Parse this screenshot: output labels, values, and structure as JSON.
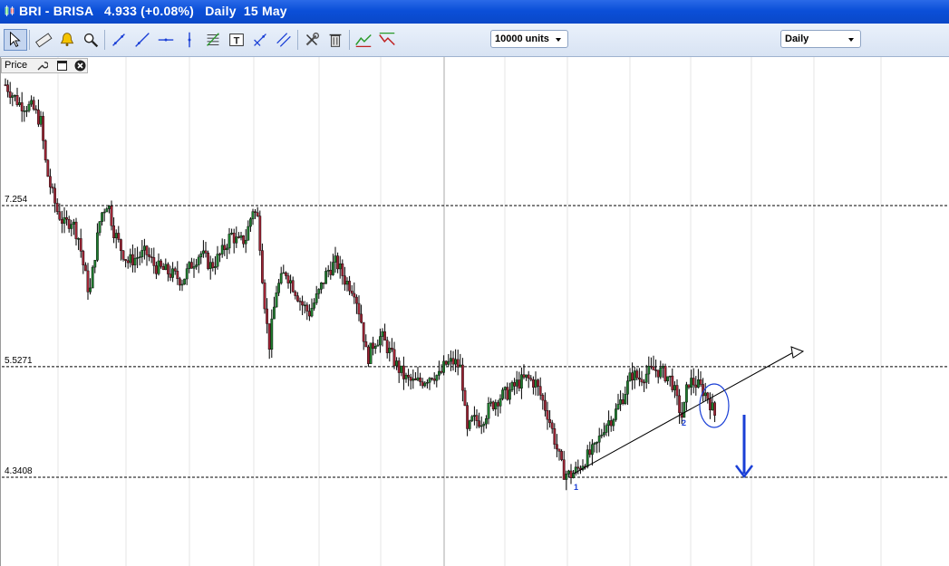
{
  "window": {
    "title": "BRI - BRISA   4.933 (+0.08%)   Daily  15 May"
  },
  "toolbar": {
    "tools": [
      {
        "icon": "pointer-icon",
        "active": true
      },
      {
        "icon": "ruler-icon"
      },
      {
        "icon": "alert-bell-icon"
      },
      {
        "icon": "zoom-icon"
      },
      {
        "icon": "trend-line-icon"
      },
      {
        "icon": "ray-line-icon"
      },
      {
        "icon": "horizontal-line-icon"
      },
      {
        "icon": "vertical-line-icon"
      },
      {
        "icon": "fibonacci-icon"
      },
      {
        "icon": "text-tool-icon"
      },
      {
        "icon": "cross-arrows-icon"
      },
      {
        "icon": "parallel-lines-icon"
      },
      {
        "icon": "tools-wrench-icon"
      },
      {
        "icon": "trash-icon"
      },
      {
        "icon": "pattern-up-icon"
      },
      {
        "icon": "pattern-down-icon"
      }
    ],
    "units_value": "10000 units",
    "interval_value": "Daily"
  },
  "panel": {
    "label": "Price"
  },
  "price_levels": [
    {
      "label": "7.254",
      "value": 7.254
    },
    {
      "label": "5.5271",
      "value": 5.5271
    },
    {
      "label": "4.3408",
      "value": 4.3408
    }
  ],
  "annotations": {
    "point_1": "1",
    "point_2": "2"
  },
  "colors": {
    "titlebar": "#0b4fd8",
    "up_candle": "#1e7a2e",
    "down_candle": "#9c2434",
    "annotation": "#1a3fd6"
  }
}
